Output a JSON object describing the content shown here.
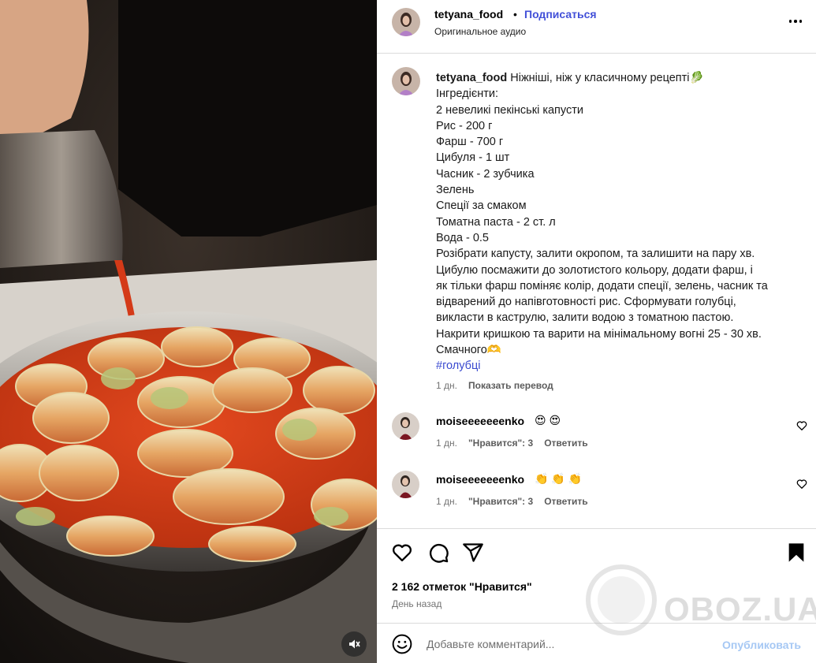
{
  "post": {
    "username": "tetyana_food",
    "separator": "•",
    "follow_label": "Подписаться",
    "audio_label": "Оригинальное аудио"
  },
  "caption": {
    "username": "tetyana_food",
    "lines": [
      "Ніжніші, ніж у класичному рецепті🥬",
      "Інгредієнти:",
      "2 невеликі пекінські капусти",
      "Рис - 200 г",
      "Фарш - 700 г",
      "Цибуля - 1 шт",
      "Часник - 2 зубчика",
      "Зелень",
      "Спеції за смаком",
      "Томатна паста - 2 ст. л",
      "Вода - 0.5",
      "Розібрати капусту, залити окропом, та залишити на пару хв.",
      "Цибулю посмажити до золотистого кольору, додати фарш, і",
      "як тільки фарш поміняє колір, додати спеції, зелень, часник та",
      "відварений до напівготовності рис. Сформувати голубці,",
      "викласти в каструлю, залити водою з томатною пастою.",
      "Накрити кришкою та варити на мінімальному вогні 25 - 30 хв.",
      "Смачного🫶"
    ],
    "hashtag": "#голубці",
    "age": "1 дн.",
    "translate_label": "Показать перевод"
  },
  "comments": [
    {
      "username": "moiseeeeeeenko",
      "text": "😍 😍",
      "age": "1 дн.",
      "likes_label": "\"Нравится\": 3",
      "reply_label": "Ответить"
    },
    {
      "username": "moiseeeeeeenko",
      "text": "👏 👏 👏",
      "age": "1 дн.",
      "likes_label": "\"Нравится\": 3",
      "reply_label": "Ответить"
    }
  ],
  "stats": {
    "likes_text": "2 162 отметок \"Нравится\"",
    "posted": "День назад"
  },
  "composer": {
    "placeholder": "Добавьте комментарий...",
    "post_label": "Опубликовать"
  },
  "watermark": {
    "text": "OBOZ.UA"
  },
  "colors": {
    "link": "#4250d8",
    "post_disabled": "#a6c8f4",
    "muted": "#737373"
  },
  "icons": [
    "more-icon",
    "heart-icon",
    "comment-icon",
    "share-icon",
    "bookmark-icon",
    "smile-icon",
    "mute-icon"
  ]
}
